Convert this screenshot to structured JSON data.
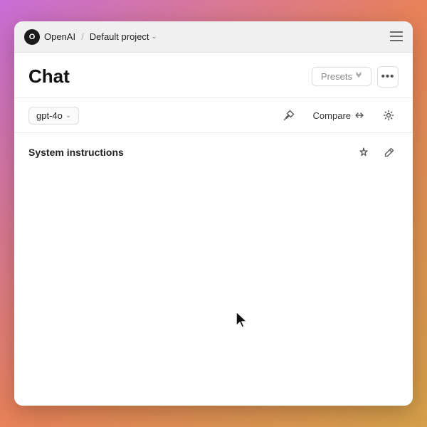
{
  "titlebar": {
    "org_initial": "O",
    "org_name": "OpenAI",
    "separator": "/",
    "project_name": "Default project",
    "menu_icon": "≡"
  },
  "page": {
    "title": "Chat",
    "presets_label": "Presets",
    "more_label": "•••"
  },
  "toolbar": {
    "model_label": "gpt-4o",
    "compare_label": "Compare"
  },
  "system_instructions": {
    "title": "System instructions"
  }
}
